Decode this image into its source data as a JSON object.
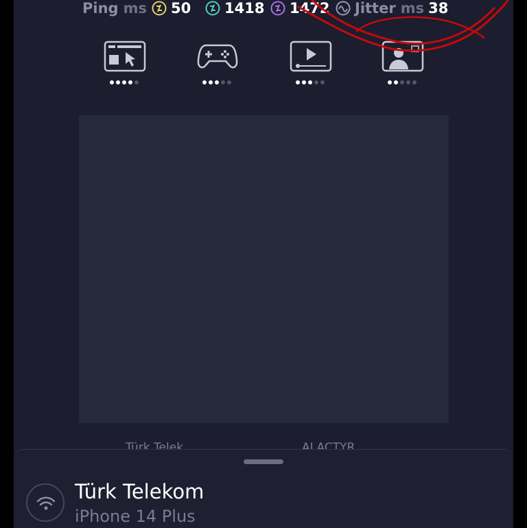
{
  "stats": {
    "ping": {
      "label": "Ping",
      "unit": "ms",
      "value": "50"
    },
    "download": {
      "value": "1418"
    },
    "upload": {
      "value": "1472"
    },
    "jitter": {
      "label": "Jitter",
      "unit": "ms",
      "value": "38"
    }
  },
  "quality": [
    {
      "icon": "web-browsing-icon",
      "level": 4
    },
    {
      "icon": "gaming-controller-icon",
      "level": 3
    },
    {
      "icon": "video-streaming-icon",
      "level": 3
    },
    {
      "icon": "video-call-icon",
      "level": 2
    }
  ],
  "quality_max": 5,
  "server_line": {
    "provider": "Türk Telek",
    "location": "ALACTYR"
  },
  "connection": {
    "provider": "Türk Telekom",
    "device": "iPhone 14 Plus"
  },
  "colors": {
    "background": "#1c1d2e",
    "ping_icon": "#e8d36a",
    "download_icon": "#4fd1c5",
    "upload_icon": "#a873e8",
    "annotation": "#c40a0a"
  }
}
